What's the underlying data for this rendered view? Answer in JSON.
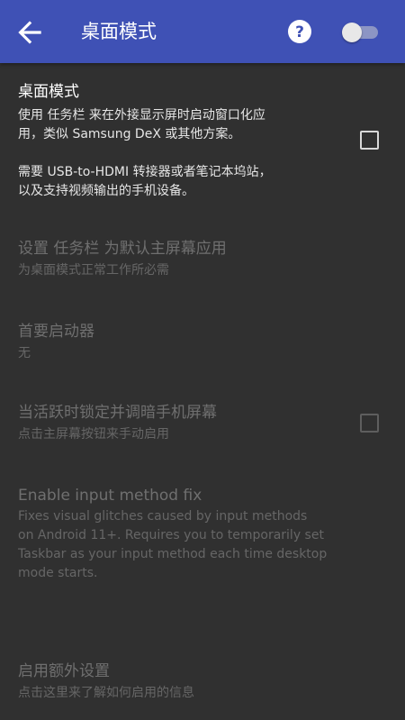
{
  "appbar": {
    "title": "桌面模式",
    "back_icon": "arrow-left-icon",
    "help_icon": "help-circle-icon",
    "switch_on": false,
    "color": "#3f51b5"
  },
  "prefs": {
    "desktop_mode": {
      "title": "桌面模式",
      "summary_line1": "使用 任务栏 来在外接显示屏时启动窗口化应",
      "summary_line2": "用，类似 Samsung DeX 或其他方案。",
      "summary_line3": "需要 USB-to-HDMI 转接器或者笔记本坞站，",
      "summary_line4": "以及支持视频输出的手机设备。",
      "checked": false
    },
    "default_home": {
      "title": "设置 任务栏 为默认主屏幕应用",
      "summary": "为桌面模式正常工作所必需"
    },
    "primary_launcher": {
      "title": "首要启动器",
      "summary": "无"
    },
    "lock_dim": {
      "title": "当活跃时锁定并调暗手机屏幕",
      "summary": "点击主屏幕按钮来手动启用",
      "checked": false
    },
    "input_fix": {
      "title": "Enable input method fix",
      "summary_line1": "Fixes visual glitches caused by input methods",
      "summary_line2": "on Android 11+. Requires you to temporarily set",
      "summary_line3": "Taskbar as your input method each time desktop",
      "summary_line4": "mode starts."
    },
    "extra_settings": {
      "title": "启用额外设置",
      "summary": "点击这里来了解如何启用的信息"
    }
  }
}
